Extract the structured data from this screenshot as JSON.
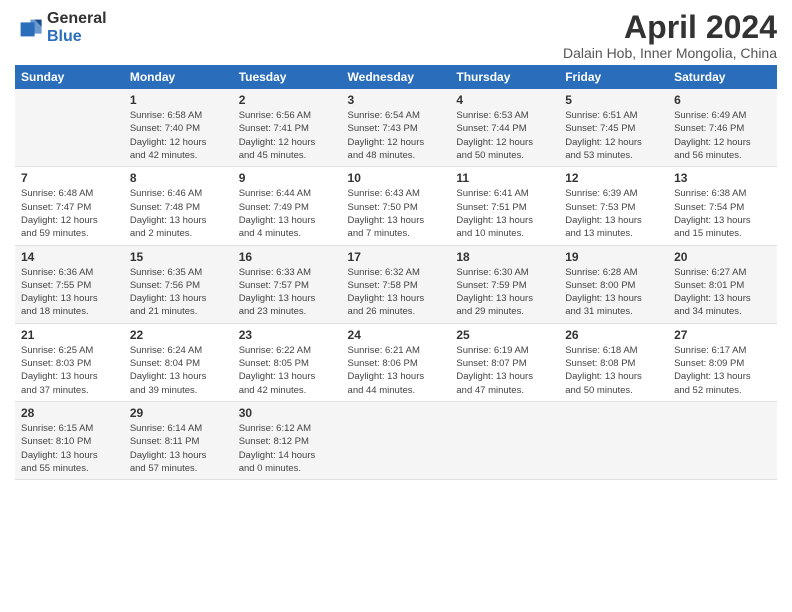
{
  "header": {
    "logo_general": "General",
    "logo_blue": "Blue",
    "month": "April 2024",
    "location": "Dalain Hob, Inner Mongolia, China"
  },
  "weekdays": [
    "Sunday",
    "Monday",
    "Tuesday",
    "Wednesday",
    "Thursday",
    "Friday",
    "Saturday"
  ],
  "weeks": [
    [
      {
        "day": "",
        "info": ""
      },
      {
        "day": "1",
        "info": "Sunrise: 6:58 AM\nSunset: 7:40 PM\nDaylight: 12 hours\nand 42 minutes."
      },
      {
        "day": "2",
        "info": "Sunrise: 6:56 AM\nSunset: 7:41 PM\nDaylight: 12 hours\nand 45 minutes."
      },
      {
        "day": "3",
        "info": "Sunrise: 6:54 AM\nSunset: 7:43 PM\nDaylight: 12 hours\nand 48 minutes."
      },
      {
        "day": "4",
        "info": "Sunrise: 6:53 AM\nSunset: 7:44 PM\nDaylight: 12 hours\nand 50 minutes."
      },
      {
        "day": "5",
        "info": "Sunrise: 6:51 AM\nSunset: 7:45 PM\nDaylight: 12 hours\nand 53 minutes."
      },
      {
        "day": "6",
        "info": "Sunrise: 6:49 AM\nSunset: 7:46 PM\nDaylight: 12 hours\nand 56 minutes."
      }
    ],
    [
      {
        "day": "7",
        "info": "Sunrise: 6:48 AM\nSunset: 7:47 PM\nDaylight: 12 hours\nand 59 minutes."
      },
      {
        "day": "8",
        "info": "Sunrise: 6:46 AM\nSunset: 7:48 PM\nDaylight: 13 hours\nand 2 minutes."
      },
      {
        "day": "9",
        "info": "Sunrise: 6:44 AM\nSunset: 7:49 PM\nDaylight: 13 hours\nand 4 minutes."
      },
      {
        "day": "10",
        "info": "Sunrise: 6:43 AM\nSunset: 7:50 PM\nDaylight: 13 hours\nand 7 minutes."
      },
      {
        "day": "11",
        "info": "Sunrise: 6:41 AM\nSunset: 7:51 PM\nDaylight: 13 hours\nand 10 minutes."
      },
      {
        "day": "12",
        "info": "Sunrise: 6:39 AM\nSunset: 7:53 PM\nDaylight: 13 hours\nand 13 minutes."
      },
      {
        "day": "13",
        "info": "Sunrise: 6:38 AM\nSunset: 7:54 PM\nDaylight: 13 hours\nand 15 minutes."
      }
    ],
    [
      {
        "day": "14",
        "info": "Sunrise: 6:36 AM\nSunset: 7:55 PM\nDaylight: 13 hours\nand 18 minutes."
      },
      {
        "day": "15",
        "info": "Sunrise: 6:35 AM\nSunset: 7:56 PM\nDaylight: 13 hours\nand 21 minutes."
      },
      {
        "day": "16",
        "info": "Sunrise: 6:33 AM\nSunset: 7:57 PM\nDaylight: 13 hours\nand 23 minutes."
      },
      {
        "day": "17",
        "info": "Sunrise: 6:32 AM\nSunset: 7:58 PM\nDaylight: 13 hours\nand 26 minutes."
      },
      {
        "day": "18",
        "info": "Sunrise: 6:30 AM\nSunset: 7:59 PM\nDaylight: 13 hours\nand 29 minutes."
      },
      {
        "day": "19",
        "info": "Sunrise: 6:28 AM\nSunset: 8:00 PM\nDaylight: 13 hours\nand 31 minutes."
      },
      {
        "day": "20",
        "info": "Sunrise: 6:27 AM\nSunset: 8:01 PM\nDaylight: 13 hours\nand 34 minutes."
      }
    ],
    [
      {
        "day": "21",
        "info": "Sunrise: 6:25 AM\nSunset: 8:03 PM\nDaylight: 13 hours\nand 37 minutes."
      },
      {
        "day": "22",
        "info": "Sunrise: 6:24 AM\nSunset: 8:04 PM\nDaylight: 13 hours\nand 39 minutes."
      },
      {
        "day": "23",
        "info": "Sunrise: 6:22 AM\nSunset: 8:05 PM\nDaylight: 13 hours\nand 42 minutes."
      },
      {
        "day": "24",
        "info": "Sunrise: 6:21 AM\nSunset: 8:06 PM\nDaylight: 13 hours\nand 44 minutes."
      },
      {
        "day": "25",
        "info": "Sunrise: 6:19 AM\nSunset: 8:07 PM\nDaylight: 13 hours\nand 47 minutes."
      },
      {
        "day": "26",
        "info": "Sunrise: 6:18 AM\nSunset: 8:08 PM\nDaylight: 13 hours\nand 50 minutes."
      },
      {
        "day": "27",
        "info": "Sunrise: 6:17 AM\nSunset: 8:09 PM\nDaylight: 13 hours\nand 52 minutes."
      }
    ],
    [
      {
        "day": "28",
        "info": "Sunrise: 6:15 AM\nSunset: 8:10 PM\nDaylight: 13 hours\nand 55 minutes."
      },
      {
        "day": "29",
        "info": "Sunrise: 6:14 AM\nSunset: 8:11 PM\nDaylight: 13 hours\nand 57 minutes."
      },
      {
        "day": "30",
        "info": "Sunrise: 6:12 AM\nSunset: 8:12 PM\nDaylight: 14 hours\nand 0 minutes."
      },
      {
        "day": "",
        "info": ""
      },
      {
        "day": "",
        "info": ""
      },
      {
        "day": "",
        "info": ""
      },
      {
        "day": "",
        "info": ""
      }
    ]
  ]
}
